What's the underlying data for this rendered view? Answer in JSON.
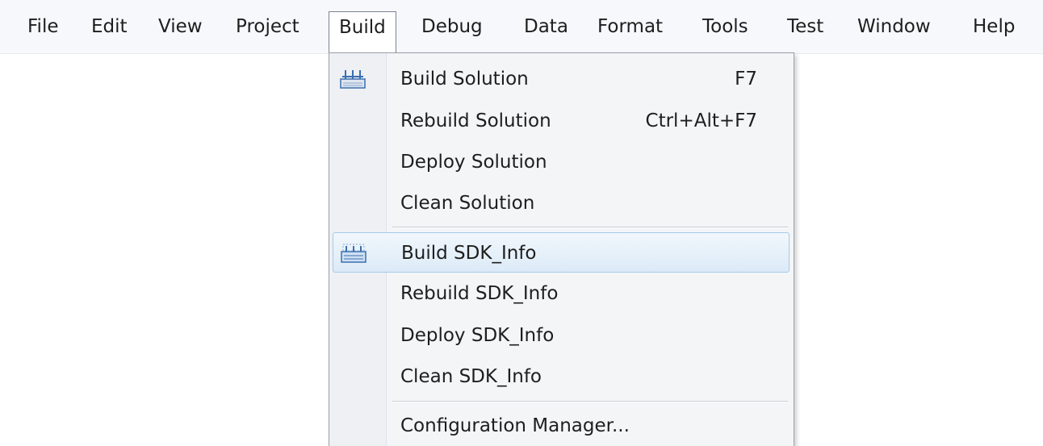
{
  "menubar": {
    "items": [
      {
        "label": "File"
      },
      {
        "label": "Edit"
      },
      {
        "label": "View"
      },
      {
        "label": "Project"
      },
      {
        "label": "Build"
      },
      {
        "label": "Debug"
      },
      {
        "label": "Data"
      },
      {
        "label": "Format"
      },
      {
        "label": "Tools"
      },
      {
        "label": "Test"
      },
      {
        "label": "Window"
      },
      {
        "label": "Help"
      }
    ],
    "active": "Build"
  },
  "build_menu": {
    "items": [
      {
        "label": "Build Solution",
        "shortcut": "F7",
        "icon": "build-solution-icon"
      },
      {
        "label": "Rebuild Solution",
        "shortcut": "Ctrl+Alt+F7"
      },
      {
        "label": "Deploy Solution"
      },
      {
        "label": "Clean Solution"
      },
      {
        "label": "Build SDK_Info",
        "icon": "build-project-icon",
        "highlighted": true
      },
      {
        "label": "Rebuild SDK_Info"
      },
      {
        "label": "Deploy SDK_Info"
      },
      {
        "label": "Clean SDK_Info"
      },
      {
        "label": "Configuration Manager..."
      }
    ]
  },
  "colors": {
    "menubar_bg": "#f6f8fb",
    "dropdown_bg": "#f4f5f7",
    "highlight_bg": "#dceaf7",
    "highlight_border": "#a7c9e6",
    "icon_blue": "#3a6fb0"
  }
}
